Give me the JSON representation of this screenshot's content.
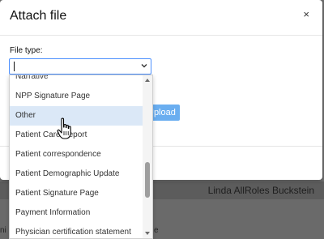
{
  "modal": {
    "title": "Attach file",
    "close_symbol": "×",
    "file_type_label": "File type:",
    "select_value": "",
    "upload_label": "Upload"
  },
  "dropdown": {
    "options": [
      "Narrative",
      "NPP Signature Page",
      "Other",
      "Patient Care Report",
      "Patient correspondence",
      "Patient Demographic Update",
      "Patient Signature Page",
      "Payment Information",
      "Physician certification statement"
    ],
    "highlighted": "Other"
  },
  "background": {
    "user_name": "Linda AllRoles Buckstein",
    "fragment_left": "ni",
    "fragment_mid": "e"
  },
  "colors": {
    "accent": "#4d90fe",
    "upload_bg": "#6aaef0",
    "highlight_bg": "#dbe8f7"
  }
}
